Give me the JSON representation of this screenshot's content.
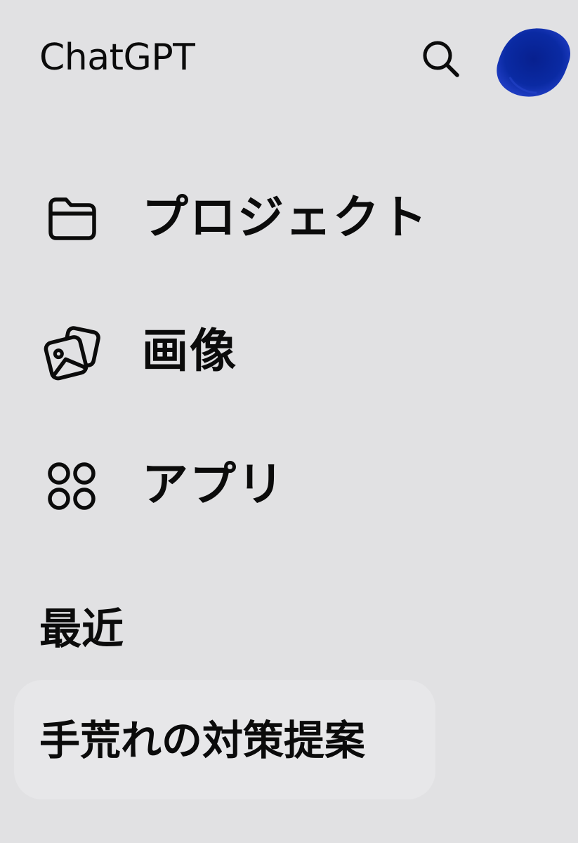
{
  "header": {
    "title": "ChatGPT",
    "search_icon": "search-icon",
    "avatar_color": "#0a2aa0"
  },
  "nav": {
    "items": [
      {
        "label": "プロジェクト",
        "icon": "folder-icon"
      },
      {
        "label": "画像",
        "icon": "images-icon"
      },
      {
        "label": "アプリ",
        "icon": "apps-grid-icon"
      }
    ]
  },
  "recent": {
    "title": "最近",
    "items": [
      {
        "label": "手荒れの対策提案"
      }
    ]
  }
}
